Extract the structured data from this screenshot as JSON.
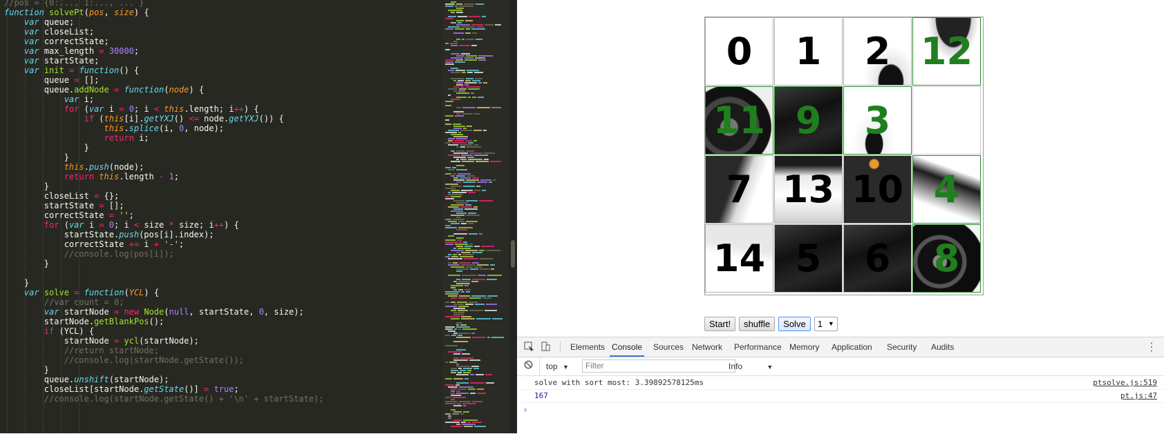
{
  "editor": {
    "lines": [
      [
        [
          "cm",
          "//pos = {0:..., 1:..., ... }"
        ]
      ],
      [
        [
          "kw",
          "function"
        ],
        [
          "pl",
          " "
        ],
        [
          "fn",
          "solvePt"
        ],
        [
          "pl",
          "("
        ],
        [
          "pa",
          "pos"
        ],
        [
          "pl",
          ", "
        ],
        [
          "pa",
          "size"
        ],
        [
          "pl",
          ") {"
        ]
      ],
      [
        [
          "pl",
          "    "
        ],
        [
          "kw",
          "var"
        ],
        [
          "pl",
          " queue;"
        ]
      ],
      [
        [
          "pl",
          "    "
        ],
        [
          "kw",
          "var"
        ],
        [
          "pl",
          " closeList;"
        ]
      ],
      [
        [
          "pl",
          "    "
        ],
        [
          "kw",
          "var"
        ],
        [
          "pl",
          " correctState;"
        ]
      ],
      [
        [
          "pl",
          "    "
        ],
        [
          "kw",
          "var"
        ],
        [
          "pl",
          " max_length "
        ],
        [
          "op",
          "="
        ],
        [
          "pl",
          " "
        ],
        [
          "nm",
          "30000"
        ],
        [
          "pl",
          ";"
        ]
      ],
      [
        [
          "pl",
          "    "
        ],
        [
          "kw",
          "var"
        ],
        [
          "pl",
          " startState;"
        ]
      ],
      [
        [
          "pl",
          "    "
        ],
        [
          "kw",
          "var"
        ],
        [
          "pl",
          " "
        ],
        [
          "fn",
          "init"
        ],
        [
          "pl",
          " "
        ],
        [
          "op",
          "="
        ],
        [
          "pl",
          " "
        ],
        [
          "kw",
          "function"
        ],
        [
          "pl",
          "() {"
        ]
      ],
      [
        [
          "pl",
          "        queue "
        ],
        [
          "op",
          "="
        ],
        [
          "pl",
          " [];"
        ]
      ],
      [
        [
          "pl",
          "        queue."
        ],
        [
          "fn",
          "addNode"
        ],
        [
          "pl",
          " "
        ],
        [
          "op",
          "="
        ],
        [
          "pl",
          " "
        ],
        [
          "kw",
          "function"
        ],
        [
          "pl",
          "("
        ],
        [
          "pa",
          "node"
        ],
        [
          "pl",
          ") {"
        ]
      ],
      [
        [
          "pl",
          "            "
        ],
        [
          "kw",
          "var"
        ],
        [
          "pl",
          " i;"
        ]
      ],
      [
        [
          "pl",
          "            "
        ],
        [
          "op",
          "for"
        ],
        [
          "pl",
          " ("
        ],
        [
          "kw",
          "var"
        ],
        [
          "pl",
          " i "
        ],
        [
          "op",
          "="
        ],
        [
          "pl",
          " "
        ],
        [
          "nm",
          "0"
        ],
        [
          "pl",
          "; i "
        ],
        [
          "op",
          "<"
        ],
        [
          "pl",
          " "
        ],
        [
          "th",
          "this"
        ],
        [
          "pl",
          ".length; i"
        ],
        [
          "op",
          "++"
        ],
        [
          "pl",
          ") {"
        ]
      ],
      [
        [
          "pl",
          "                "
        ],
        [
          "op",
          "if"
        ],
        [
          "pl",
          " ("
        ],
        [
          "th",
          "this"
        ],
        [
          "pl",
          "[i]."
        ],
        [
          "kw",
          "getYXJ"
        ],
        [
          "pl",
          "() "
        ],
        [
          "op",
          "<="
        ],
        [
          "pl",
          " node."
        ],
        [
          "kw",
          "getYXJ"
        ],
        [
          "pl",
          "()) {"
        ]
      ],
      [
        [
          "pl",
          "                    "
        ],
        [
          "th",
          "this"
        ],
        [
          "pl",
          "."
        ],
        [
          "kw",
          "splice"
        ],
        [
          "pl",
          "(i, "
        ],
        [
          "nm",
          "0"
        ],
        [
          "pl",
          ", node);"
        ]
      ],
      [
        [
          "pl",
          "                    "
        ],
        [
          "op",
          "return"
        ],
        [
          "pl",
          " i;"
        ]
      ],
      [
        [
          "pl",
          "                }"
        ]
      ],
      [
        [
          "pl",
          "            }"
        ]
      ],
      [
        [
          "pl",
          "            "
        ],
        [
          "th",
          "this"
        ],
        [
          "pl",
          "."
        ],
        [
          "kw",
          "push"
        ],
        [
          "pl",
          "(node);"
        ]
      ],
      [
        [
          "pl",
          "            "
        ],
        [
          "op",
          "return"
        ],
        [
          "pl",
          " "
        ],
        [
          "th",
          "this"
        ],
        [
          "pl",
          ".length "
        ],
        [
          "op",
          "-"
        ],
        [
          "pl",
          " "
        ],
        [
          "nm",
          "1"
        ],
        [
          "pl",
          ";"
        ]
      ],
      [
        [
          "pl",
          "        }"
        ]
      ],
      [
        [
          "pl",
          "        closeList "
        ],
        [
          "op",
          "="
        ],
        [
          "pl",
          " {};"
        ]
      ],
      [
        [
          "pl",
          "        startState "
        ],
        [
          "op",
          "="
        ],
        [
          "pl",
          " [];"
        ]
      ],
      [
        [
          "pl",
          "        correctState "
        ],
        [
          "op",
          "="
        ],
        [
          "pl",
          " "
        ],
        [
          "st",
          "''"
        ],
        [
          "pl",
          ";"
        ]
      ],
      [
        [
          "pl",
          "        "
        ],
        [
          "op",
          "for"
        ],
        [
          "pl",
          " ("
        ],
        [
          "kw",
          "var"
        ],
        [
          "pl",
          " i "
        ],
        [
          "op",
          "="
        ],
        [
          "pl",
          " "
        ],
        [
          "nm",
          "0"
        ],
        [
          "pl",
          "; i "
        ],
        [
          "op",
          "<"
        ],
        [
          "pl",
          " size "
        ],
        [
          "op",
          "*"
        ],
        [
          "pl",
          " size; i"
        ],
        [
          "op",
          "++"
        ],
        [
          "pl",
          ") {"
        ]
      ],
      [
        [
          "pl",
          "            startState."
        ],
        [
          "kw",
          "push"
        ],
        [
          "pl",
          "(pos[i].index);"
        ]
      ],
      [
        [
          "pl",
          "            correctState "
        ],
        [
          "op",
          "+="
        ],
        [
          "pl",
          " i "
        ],
        [
          "op",
          "+"
        ],
        [
          "pl",
          " "
        ],
        [
          "st",
          "'-'"
        ],
        [
          "pl",
          ";"
        ]
      ],
      [
        [
          "pl",
          "            "
        ],
        [
          "cm",
          "//console.log(pos[i]);"
        ]
      ],
      [
        [
          "pl",
          "        }"
        ]
      ],
      [
        [
          "pl",
          ""
        ]
      ],
      [
        [
          "pl",
          "    }"
        ]
      ],
      [
        [
          "pl",
          "    "
        ],
        [
          "kw",
          "var"
        ],
        [
          "pl",
          " "
        ],
        [
          "fn",
          "solve"
        ],
        [
          "pl",
          " "
        ],
        [
          "op",
          "="
        ],
        [
          "pl",
          " "
        ],
        [
          "kw",
          "function"
        ],
        [
          "pl",
          "("
        ],
        [
          "pa",
          "YCL"
        ],
        [
          "pl",
          ") {"
        ]
      ],
      [
        [
          "pl",
          "        "
        ],
        [
          "cm",
          "//var count = 0;"
        ]
      ],
      [
        [
          "pl",
          "        "
        ],
        [
          "kw",
          "var"
        ],
        [
          "pl",
          " startNode "
        ],
        [
          "op",
          "="
        ],
        [
          "pl",
          " "
        ],
        [
          "op",
          "new"
        ],
        [
          "pl",
          " "
        ],
        [
          "fn",
          "Node"
        ],
        [
          "pl",
          "("
        ],
        [
          "nm",
          "null"
        ],
        [
          "pl",
          ", startState, "
        ],
        [
          "nm",
          "0"
        ],
        [
          "pl",
          ", size);"
        ]
      ],
      [
        [
          "pl",
          "        startNode."
        ],
        [
          "fn",
          "getBlankPos"
        ],
        [
          "pl",
          "();"
        ]
      ],
      [
        [
          "pl",
          "        "
        ],
        [
          "op",
          "if"
        ],
        [
          "pl",
          " (YCL) {"
        ]
      ],
      [
        [
          "pl",
          "            startNode "
        ],
        [
          "op",
          "="
        ],
        [
          "pl",
          " "
        ],
        [
          "fn",
          "ycl"
        ],
        [
          "pl",
          "(startNode);"
        ]
      ],
      [
        [
          "pl",
          "            "
        ],
        [
          "cm",
          "//return startNode;"
        ]
      ],
      [
        [
          "pl",
          "            "
        ],
        [
          "cm",
          "//console.log(startNode.getState());"
        ]
      ],
      [
        [
          "pl",
          "        }"
        ]
      ],
      [
        [
          "pl",
          "        queue."
        ],
        [
          "kw",
          "unshift"
        ],
        [
          "pl",
          "(startNode);"
        ]
      ],
      [
        [
          "pl",
          "        closeList[startNode."
        ],
        [
          "kw",
          "getState"
        ],
        [
          "pl",
          "()] "
        ],
        [
          "op",
          "="
        ],
        [
          "pl",
          " "
        ],
        [
          "nm",
          "true"
        ],
        [
          "pl",
          ";"
        ]
      ],
      [
        [
          "pl",
          "        "
        ],
        [
          "cm",
          "//console.log(startNode.getState() + '\\n' + startState);"
        ]
      ]
    ]
  },
  "puzzle": {
    "tiles": [
      {
        "label": "0",
        "state": "plain",
        "photo": "none"
      },
      {
        "label": "1",
        "state": "plain",
        "photo": "none"
      },
      {
        "label": "2",
        "state": "plain",
        "photo": "fairing"
      },
      {
        "label": "12",
        "state": "correct",
        "photo": "tail"
      },
      {
        "label": "11",
        "state": "correct",
        "photo": "wheel"
      },
      {
        "label": "9",
        "state": "correct",
        "photo": "dark"
      },
      {
        "label": "3",
        "state": "correct",
        "photo": "mirror"
      },
      {
        "label": "",
        "state": "blank",
        "photo": "none"
      },
      {
        "label": "7",
        "state": "plain",
        "photo": "fairing-left"
      },
      {
        "label": "13",
        "state": "plain",
        "photo": "light"
      },
      {
        "label": "10",
        "state": "plain",
        "photo": "dark-light"
      },
      {
        "label": "4",
        "state": "correct",
        "photo": "tail-light"
      },
      {
        "label": "14",
        "state": "plain",
        "photo": "fairing-low"
      },
      {
        "label": "5",
        "state": "plain",
        "photo": "dark"
      },
      {
        "label": "6",
        "state": "plain",
        "photo": "dark"
      },
      {
        "label": "8",
        "state": "correct",
        "photo": "exhaust"
      }
    ],
    "colors": {
      "plain": "#000000",
      "correct": "#1f7f1f"
    }
  },
  "controls": {
    "start_label": "Start!",
    "shuffle_label": "shuffle",
    "solve_label": "Solve",
    "select_value": "1"
  },
  "devtools": {
    "tabs": [
      "Elements",
      "Console",
      "Sources",
      "Network",
      "Performance",
      "Memory",
      "Application",
      "Security",
      "Audits"
    ],
    "active_tab": "Console",
    "context": "top",
    "filter_placeholder": "Filter",
    "level": "Info",
    "logs": [
      {
        "message": "solve with sort most: 3.39892578125ms",
        "source": "ptsolve.js:519",
        "color": "#333333"
      },
      {
        "message": "167",
        "source": "pt.js:47",
        "color": "#1a1aa6"
      }
    ],
    "prompt": "›"
  }
}
